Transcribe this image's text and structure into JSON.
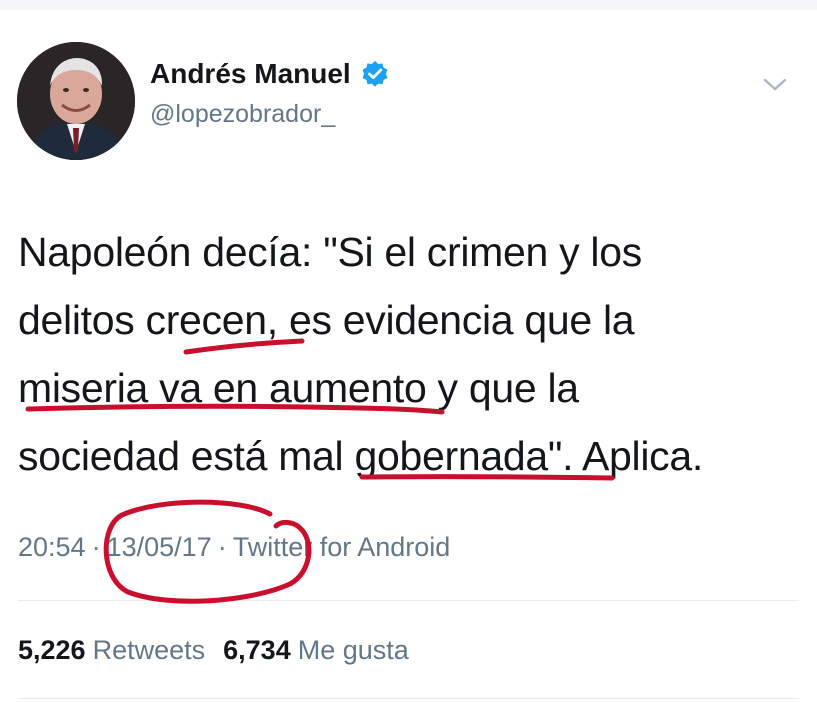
{
  "author": {
    "display_name": "Andrés Manuel",
    "handle": "@lopezobrador_",
    "verified": true
  },
  "tweet": {
    "lines": [
      "Napoleón decía: \"Si el crimen y los",
      "delitos crecen, es evidencia que la",
      "miseria va en aumento y que la",
      "sociedad está mal gobernada\". Aplica."
    ]
  },
  "meta": {
    "time": "20:54",
    "separator": "·",
    "date": "13/05/17",
    "source": "Twitter for Android"
  },
  "stats": {
    "retweets_count": "5,226",
    "retweets_label": "Retweets",
    "likes_count": "6,734",
    "likes_label": "Me gusta"
  },
  "colors": {
    "text": "#14171a",
    "secondary": "#657786",
    "verified": "#1da1f2",
    "annotation": "#c8102e"
  },
  "icons": [
    "verified-icon",
    "chevron-down-icon"
  ]
}
